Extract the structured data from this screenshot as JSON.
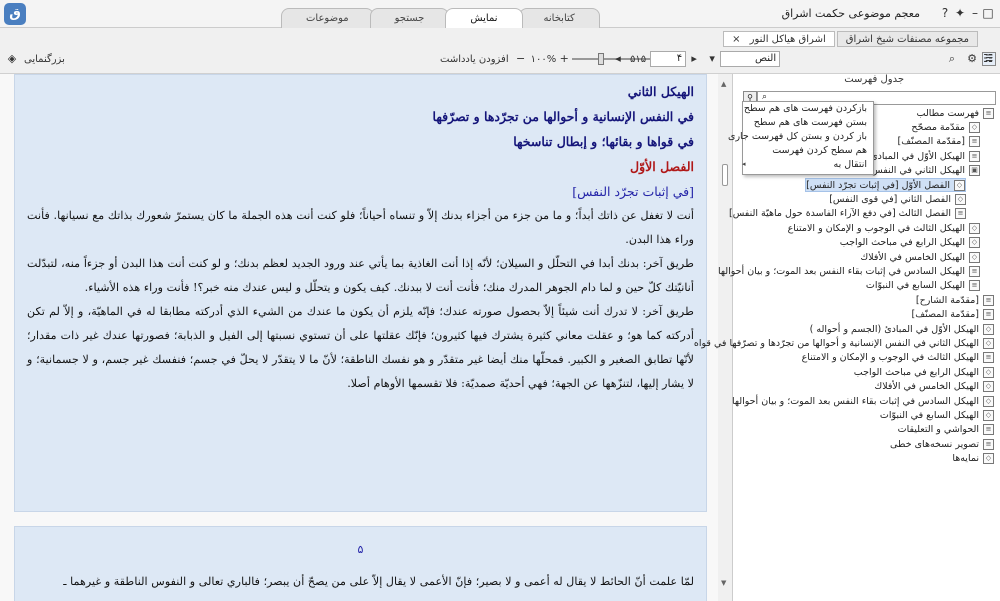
{
  "app": {
    "title": "معجم موضوعی حکمت اشراق"
  },
  "window_icons": [
    "help-icon",
    "pin-icon",
    "minimize-icon",
    "maximize-icon",
    "close-icon"
  ],
  "main_tabs": [
    {
      "label": "کتابخانه",
      "active": false
    },
    {
      "label": "نمایش",
      "active": true
    },
    {
      "label": "جستجو",
      "active": false
    },
    {
      "label": "موضوعات",
      "active": false
    }
  ],
  "doc_tabs": [
    {
      "label": "مجموعه مصنفات شیخ اشراق",
      "active": false
    },
    {
      "label": "اشراق هیاکل النور",
      "active": true,
      "close": "×"
    }
  ],
  "toolbar": {
    "view_mode": "النص",
    "page_current": "۴",
    "page_total": "۵۱۵",
    "zoom": "۱۰۰%",
    "bookmark_label": "افزودن یادداشت",
    "zoom_mode_label": "بزرگنمایی",
    "zoom_level": 0.35
  },
  "reader": {
    "h1": "الهيكل الثاني",
    "h2": "في النفس الإنسانية و أحوالها من تجرّدها و تصرّفها",
    "h3": "في قواها و بقائها؛ و إبطال تناسخها",
    "section": "الفصل الأوّل",
    "subsection": "[في إثبات تجرّد النفس]",
    "paragraphs": [
      "أنت لا تغفل عن ذاتك أبداً؛ و ما من جزء من أجزاء بدنك إلاّ و تنساه أحياناً؛ فلو كنت أنت هذه الجملة ما كان يستمرّ شعورك بذاتك مع نسيانها. فأنت وراء هذا البدن.",
      "طريق آخر: بدنك أبدا في التحلّل و السيلان؛ لأنّه إذا أنت الغاذية بما يأتي عند ورود الجديد لعظم بدنك؛ و لو كنت أنت هذا البدن أو جزءاً منه، لتبدّلت أنانيّتك كلّ حين و لما دام الجوهر المدرك منك؛ فأنت أنت لا ببدنك. كيف يكون و يتحلّل و ليس عندك منه خبر؟! فأنت وراء هذه الأشياء.",
      "طريق آخر: لا تدرك أنت شيئاً إلاّ بحصول صورته عندك؛ فإنّه يلزم أن يكون ما عندك من الشيء الذي أدركته مطابقا له في الماهيّة، و إلاّ لم تكن أدركته كما هو؛ و عقلت معاني كثيرة يشترك فيها كثيرون؛ فإنّك عقلتها على أن تستوي نسبتها إلى الفيل و الذبابة؛ فصورتها عندك غير ذات مقدار؛ لأنّها تطابق الصغير و الكبير. فمحلّها منك أيضا غير متقدّر و هو نفسك الناطقة؛ لأنّ ما لا يتقدّر لا يحلّ في جسم؛ فنفسك غير جسم، و لا جسمانية؛ و لا يشار إليها، لتنزّهها عن الجهة؛ فهي أحديّة صمديّة: فلا تقسمها الأوهام أصلا."
    ],
    "page2_number": "۵",
    "page2_line": "لمّا علمت أنّ الحائط لا يقال له أعمى و لا بصير؛ فإنّ الأعمى لا يقال إلاّ على من يصحّ أن يبصر؛ فالباري تعالى و النفوس الناطقة و غيرهما ـ"
  },
  "sidebar": {
    "title": "جدول فهرست",
    "search_placeholder": "",
    "context_menu": [
      "بازکردن فهرست های هم سطح",
      "بستن فهرست های هم سطح",
      "باز کردن و بستن کل فهرست جاری",
      "هم سطح کردن فهرست",
      "انتقال به"
    ],
    "items": [
      {
        "label": "فهرست مطالب",
        "level": 0,
        "icon": "page"
      },
      {
        "label": "مقدّمة مصحّح",
        "level": 1,
        "icon": "leaf"
      },
      {
        "label": "[مقدّمة المصنّف]",
        "level": 1,
        "icon": "page"
      },
      {
        "label": "الهيكل الأوّل في المبادئ",
        "level": 1,
        "icon": "page"
      },
      {
        "label": "الهيكل الثاني في النفس",
        "level": 1,
        "icon": "book"
      },
      {
        "label": "الفصل الأوّل [في إثبات تجرّد النفس]",
        "level": 2,
        "icon": "leaf",
        "selected": true
      },
      {
        "label": "الفصل الثاني [في قوى النفس]",
        "level": 2,
        "icon": "leaf"
      },
      {
        "label": "الفصل الثالث [في دفع الآراء الفاسدة حول ماهيّة النفس]",
        "level": 2,
        "icon": "page"
      },
      {
        "label": "الهيكل الثالث في الوجوب و الإمكان و الامتناع",
        "level": 1,
        "icon": "leaf"
      },
      {
        "label": "الهيكل الرابع في مباحث الواجب",
        "level": 1,
        "icon": "leaf"
      },
      {
        "label": "الهيكل الخامس في الأفلاك",
        "level": 1,
        "icon": "leaf"
      },
      {
        "label": "الهيكل السادس في إثبات بقاء النفس بعد الموت؛ و بيان أحوالها",
        "level": 1,
        "icon": "page"
      },
      {
        "label": "الهيكل السابع في النبوّات",
        "level": 1,
        "icon": "page"
      },
      {
        "label": "[مقدّمة الشارح]",
        "level": 0,
        "icon": "page"
      },
      {
        "label": "[مقدّمة المصنّف]",
        "level": 0,
        "icon": "page"
      },
      {
        "label": "الهيكل الأوّل في المبادئ (الجسم و أحواله )",
        "level": 0,
        "icon": "leaf"
      },
      {
        "label": "الهيكل الثاني في النفس الإنسانية و أحوالها من تجرّدها و تصرّفها في قواه",
        "level": 0,
        "icon": "leaf"
      },
      {
        "label": "الهيكل الثالث في الوجوب و الإمكان و الامتناع",
        "level": 0,
        "icon": "page"
      },
      {
        "label": "الهيكل الرابع في مباحث الواجب",
        "level": 0,
        "icon": "leaf"
      },
      {
        "label": "الهيكل الخامس في الأفلاك",
        "level": 0,
        "icon": "leaf"
      },
      {
        "label": "الهيكل السادس في إثبات بقاء النفس بعد الموت؛ و بيان أحوالها",
        "level": 0,
        "icon": "leaf"
      },
      {
        "label": "الهيكل السابع في النبوّات",
        "level": 0,
        "icon": "leaf"
      },
      {
        "label": "الحواشي و التعليقات",
        "level": 0,
        "icon": "page"
      },
      {
        "label": "تصویر نسخه‌های خطی",
        "level": 0,
        "icon": "page"
      },
      {
        "label": "نمایه‌ها",
        "level": 0,
        "icon": "leaf"
      }
    ]
  },
  "colors": {
    "accent": "#2424a8",
    "heading": "#15157a",
    "red": "#b01818",
    "page_bg": "#dde8f5",
    "selection": "#cfe0f5"
  }
}
